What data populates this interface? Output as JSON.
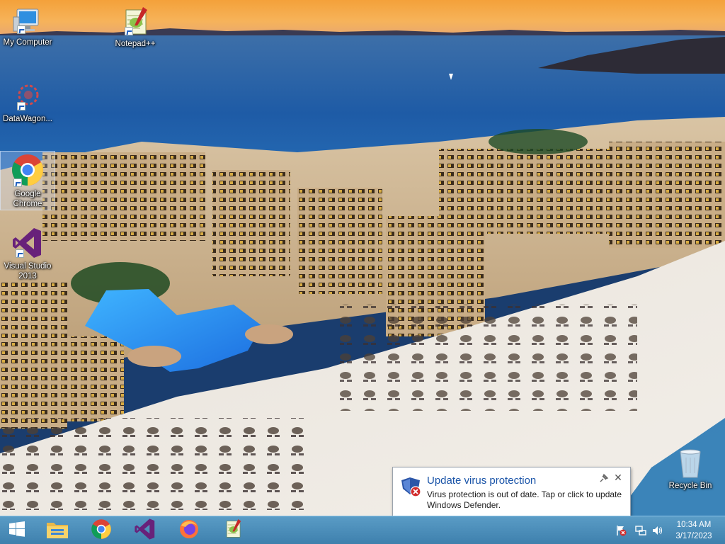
{
  "desktop": {
    "icons": [
      {
        "label": "My Computer"
      },
      {
        "label": "Notepad++"
      },
      {
        "label": "DataWagon..."
      },
      {
        "label": "Google Chrome"
      },
      {
        "label": "Visual Studio 2013"
      },
      {
        "label": "Recycle Bin"
      }
    ]
  },
  "notification": {
    "title": "Update virus protection",
    "body": "Virus protection is out of date. Tap or click to update Windows Defender.",
    "pin_icon": "pin-icon",
    "close_glyph": "✕"
  },
  "taskbar": {
    "start_icon": "windows-logo-icon",
    "pinned": [
      {
        "name": "file-explorer-icon"
      },
      {
        "name": "chrome-icon"
      },
      {
        "name": "visual-studio-icon"
      },
      {
        "name": "firefox-icon"
      },
      {
        "name": "notepad-plus-plus-icon"
      }
    ],
    "tray": [
      "action-center-flag-icon",
      "network-icon",
      "volume-icon"
    ],
    "clock": {
      "time": "10:34 AM",
      "date": "3/17/2023"
    }
  },
  "colors": {
    "taskbar": "#4a8cb9",
    "balloon_title": "#1a54a8"
  }
}
